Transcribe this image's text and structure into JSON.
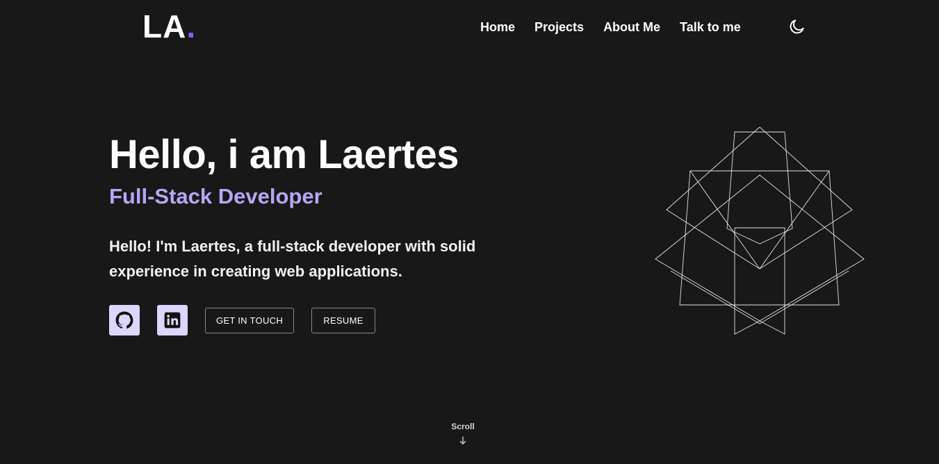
{
  "header": {
    "logo_text": "LA",
    "logo_dot": ".",
    "nav": [
      {
        "label": "Home"
      },
      {
        "label": "Projects"
      },
      {
        "label": "About Me"
      },
      {
        "label": "Talk to me"
      }
    ],
    "theme_toggle_icon": "moon-icon"
  },
  "hero": {
    "title": "Hello, i am Laertes",
    "subtitle": "Full-Stack Developer",
    "description": "Hello! I'm Laertes, a full-stack developer with solid experience in creating web applications.",
    "buttons": {
      "github_icon": "github-icon",
      "linkedin_icon": "linkedin-icon",
      "contact_label": "GET IN TOUCH",
      "resume_label": "RESUME"
    },
    "illustration_icon": "geometric-wireframe"
  },
  "scroll": {
    "label": "Scroll",
    "icon": "arrow-down-icon"
  },
  "colors": {
    "background": "#181818",
    "accent": "#8b5cf6",
    "subtitle": "#b9a6f5",
    "icon_button_bg": "#ddd6fe",
    "text": "#ffffff"
  }
}
